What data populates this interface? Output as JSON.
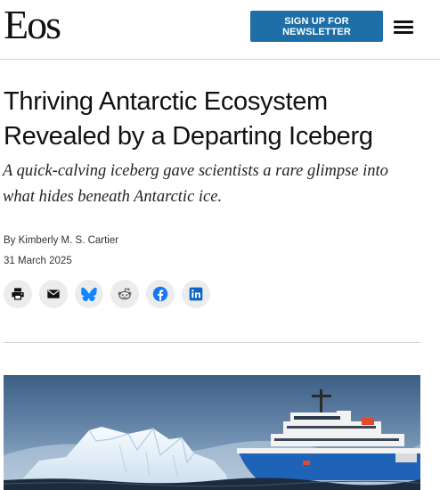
{
  "header": {
    "logo_text": "Eos",
    "newsletter_label": "SIGN UP FOR NEWSLETTER",
    "menu_icon": "hamburger-menu-icon"
  },
  "article": {
    "title": "Thriving Antarctic Ecosystem Revealed by a Departing Iceberg",
    "dek": "A quick-calving iceberg gave scientists a rare glimpse into what hides beneath Antarctic ice.",
    "byline_prefix": "By",
    "author": "Kimberly M. S. Cartier",
    "date": "31 March 2025"
  },
  "share": {
    "buttons": [
      {
        "icon": "print-icon",
        "color": "#111111"
      },
      {
        "icon": "email-icon",
        "color": "#111111"
      },
      {
        "icon": "bluesky-icon",
        "color": "#1185fe"
      },
      {
        "icon": "reddit-icon",
        "color": "#555555"
      },
      {
        "icon": "facebook-icon",
        "color": "#1877f2"
      },
      {
        "icon": "linkedin-icon",
        "color": "#0a66c2"
      }
    ]
  },
  "hero": {
    "description_icon": "iceberg-and-research-ship-photo",
    "colors": {
      "sky_top": "#3d5f86",
      "sky_bottom": "#8fa9c4",
      "ship_hull": "#1f63b8",
      "ship_superstructure": "#f2f2f2",
      "ice": "#e9f1f8",
      "sea": "#1c2c3e"
    }
  },
  "colors": {
    "accent": "#1e6fa8",
    "text": "#111111",
    "share_bg": "#ececec"
  }
}
